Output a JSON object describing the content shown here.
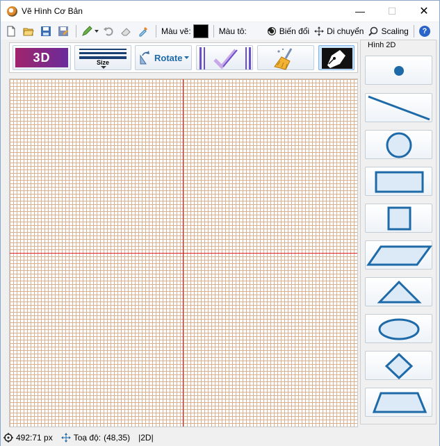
{
  "window": {
    "title": "Vẽ Hình Cơ Bản",
    "min_glyph": "—",
    "max_glyph": "☐",
    "close_glyph": "✕"
  },
  "toolbar": {
    "draw_color_label": "Màu vẽ:",
    "draw_color": "#000000",
    "fill_color_label": "Màu tô:",
    "transform_label": "Biến đổi",
    "move_label": "Di chuyển",
    "scaling_label": "Scaling",
    "help_glyph": "?"
  },
  "buttons": {
    "three_d_label": "3D",
    "size_label": "Size",
    "rotate_label": "Rotate"
  },
  "panel": {
    "title": "Hình 2D",
    "shapes": [
      "point",
      "line",
      "circle",
      "rectangle",
      "square",
      "parallelogram",
      "triangle",
      "ellipse",
      "diamond",
      "trapezoid"
    ]
  },
  "status": {
    "size_text": "492:71 px",
    "coord_label": "Toạ độ:",
    "coord_value": "(48,35)",
    "mode_text": "|2D|"
  },
  "colors": {
    "accent": "#1e6aa8",
    "axis": "#e02020",
    "grid": "#d8b090",
    "three_d_bg": "#a0246c"
  }
}
